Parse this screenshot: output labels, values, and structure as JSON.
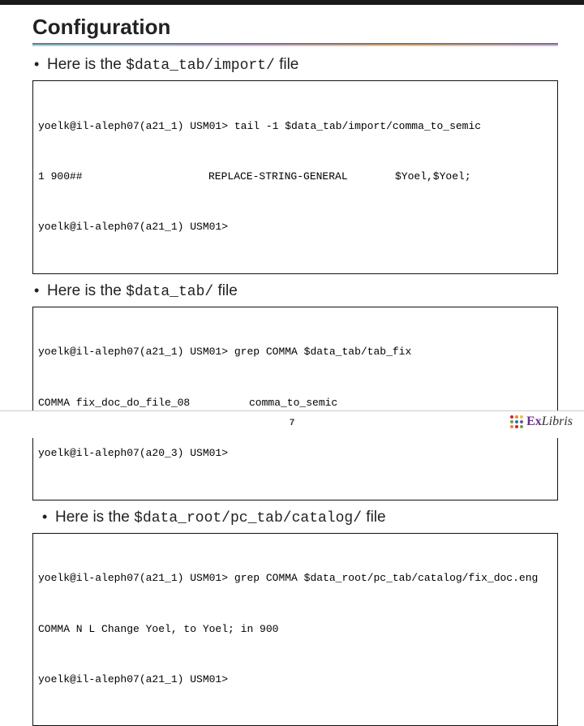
{
  "title": "Configuration",
  "bullets": {
    "b1_pre": "Here is the ",
    "b1_code": "$data_tab/import/",
    "b1_post": " file",
    "b2_pre": "Here is the ",
    "b2_code": "$data_tab/",
    "b2_post": " file",
    "b3_pre": "Here is the ",
    "b3_code": "$data_root/pc_tab/catalog/",
    "b3_post": " file"
  },
  "block1": {
    "line1": "yoelk@il-aleph07(a21_1) USM01> tail -1 $data_tab/import/comma_to_semic",
    "c1": "1 900##",
    "c2": "REPLACE-STRING-GENERAL",
    "c3": "$Yoel,$Yoel;",
    "line3": "yoelk@il-aleph07(a21_1) USM01>"
  },
  "block2": {
    "line1": "yoelk@il-aleph07(a21_1) USM01> grep COMMA $data_tab/tab_fix",
    "c1": "COMMA fix_doc_do_file_08",
    "c2": "comma_to_semic",
    "line3": "yoelk@il-aleph07(a20_3) USM01>"
  },
  "block3": {
    "line1": "yoelk@il-aleph07(a21_1) USM01> grep COMMA $data_root/pc_tab/catalog/fix_doc.eng",
    "line2": "COMMA N L Change Yoel, to Yoel; in 900",
    "line3": "yoelk@il-aleph07(a21_1) USM01>"
  },
  "footer": {
    "page": "7",
    "brand": "Libris"
  }
}
